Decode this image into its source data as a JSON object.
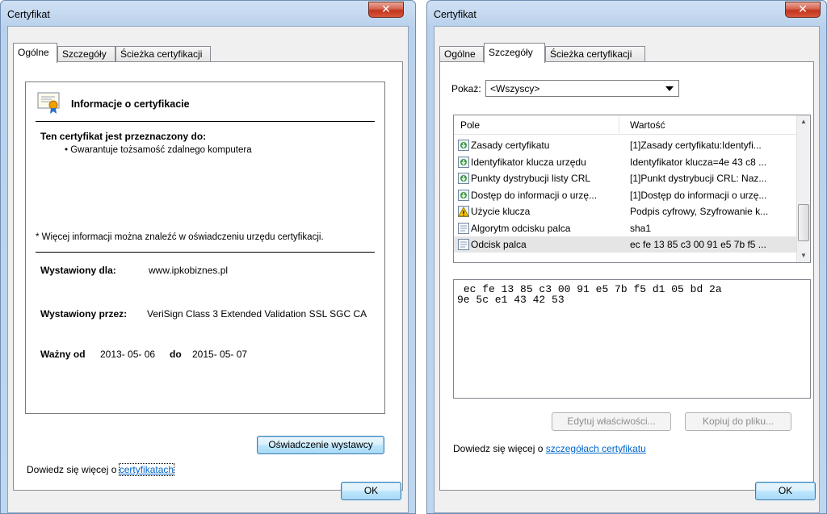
{
  "left": {
    "title": "Certyfikat",
    "tabs": [
      "Ogólne",
      "Szczegóły",
      "Ścieżka certyfikacji"
    ],
    "info_title": "Informacje o certyfikacie",
    "purpose_heading": "Ten certyfikat jest przeznaczony do:",
    "purpose_item": "• Gwarantuje tożsamość zdalnego komputera",
    "note": "* Więcej informacji można znaleźć w oświadczeniu urzędu certyfikacji.",
    "issued_to_label": "Wystawiony dla:",
    "issued_to_value": "www.ipkobiznes.pl",
    "issued_by_label": "Wystawiony przez:",
    "issued_by_value": "VeriSign Class 3 Extended Validation SSL SGC CA",
    "valid_from_label": "Ważny od",
    "valid_from_value": "2013- 05- 06",
    "valid_to_label": "do",
    "valid_to_value": "2015- 05- 07",
    "issuer_statement_button": "Oświadczenie wystawcy",
    "learn_more_prefix": "Dowiedz się więcej o ",
    "learn_more_link": "certyfikatach",
    "ok": "OK"
  },
  "right": {
    "title": "Certyfikat",
    "tabs": [
      "Ogólne",
      "Szczegóły",
      "Ścieżka certyfikacji"
    ],
    "show_label": "Pokaż:",
    "show_value": "<Wszyscy>",
    "columns": [
      "Pole",
      "Wartość"
    ],
    "rows": [
      {
        "field": "Zasady certyfikatu",
        "value": "[1]Zasady certyfikatu:Identyfi...",
        "icon": "ext"
      },
      {
        "field": "Identyfikator klucza urzędu",
        "value": "Identyfikator klucza=4e 43 c8 ...",
        "icon": "ext"
      },
      {
        "field": "Punkty dystrybucji listy CRL",
        "value": "[1]Punkt dystrybucji CRL: Naz...",
        "icon": "ext"
      },
      {
        "field": "Dostęp do informacji o urzę...",
        "value": "[1]Dostęp do informacji o urzę...",
        "icon": "ext"
      },
      {
        "field": "Użycie klucza",
        "value": "Podpis cyfrowy, Szyfrowanie k...",
        "icon": "warn"
      },
      {
        "field": "Algorytm odcisku palca",
        "value": "sha1",
        "icon": "prop"
      },
      {
        "field": "Odcisk palca",
        "value": "ec fe 13 85 c3 00 91 e5 7b f5 ...",
        "icon": "prop"
      }
    ],
    "selected_row": 6,
    "detail_text": " ec fe 13 85 c3 00 91 e5 7b f5 d1 05 bd 2a\n9e 5c e1 43 42 53",
    "edit_properties_button": "Edytuj właściwości...",
    "copy_to_file_button": "Kopiuj do pliku...",
    "learn_more_prefix": "Dowiedz się więcej o ",
    "learn_more_link": "szczegółach certyfikatu",
    "ok": "OK"
  },
  "colors": {
    "accent": "#3c7fb1",
    "link": "#0066cc",
    "close": "#c0351f"
  }
}
